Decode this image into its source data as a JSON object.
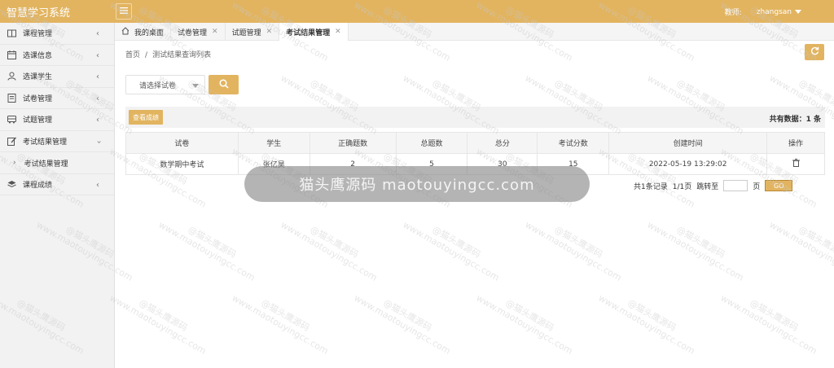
{
  "app": {
    "title": "智慧学习系统"
  },
  "header": {
    "role_label": "教师:",
    "username": "zhangsan"
  },
  "sidebar": {
    "items": [
      {
        "label": "课程管理",
        "icon": "book-icon"
      },
      {
        "label": "选课信息",
        "icon": "calendar-icon"
      },
      {
        "label": "选课学生",
        "icon": "user-icon"
      },
      {
        "label": "试卷管理",
        "icon": "paper-icon"
      },
      {
        "label": "试题管理",
        "icon": "bus-icon"
      },
      {
        "label": "考试结果管理",
        "icon": "edit-icon"
      }
    ],
    "sub_item": "考试结果管理",
    "last_item": {
      "label": "课程成绩",
      "icon": "layers-icon"
    }
  },
  "tabs": [
    {
      "label": "我的桌面",
      "icon": "home-icon"
    },
    {
      "label": "试卷管理"
    },
    {
      "label": "试题管理"
    },
    {
      "label": "考试结果管理"
    }
  ],
  "breadcrumb": {
    "home": "首页",
    "separator": "/",
    "current": "测试结果查询列表"
  },
  "filter": {
    "select_placeholder": "请选择试卷"
  },
  "toolbar": {
    "view_scores_label": "查看成绩",
    "total_label": "共有数据：1 条"
  },
  "table": {
    "headers": [
      "试卷",
      "学生",
      "正确题数",
      "总题数",
      "总分",
      "考试分数",
      "创建时间",
      "操作"
    ],
    "rows": [
      [
        "数学期中考试",
        "张亿昊",
        "2",
        "5",
        "30",
        "15",
        "2022-05-19 13:29:02"
      ]
    ]
  },
  "pager": {
    "records": "共1条记录",
    "pages": "1/1页",
    "jump_to": "跳转至",
    "page_unit": "页",
    "go": "GO"
  },
  "watermark": {
    "banner": "猫头鹰源码 maotouyingcc.com",
    "line1": "@猫头鹰源码",
    "line2": "www.maotouyingcc.com"
  },
  "colors": {
    "accent": "#e2b460",
    "sidebar_bg": "#f2f2f2",
    "header_bg": "#f5f5f5"
  }
}
